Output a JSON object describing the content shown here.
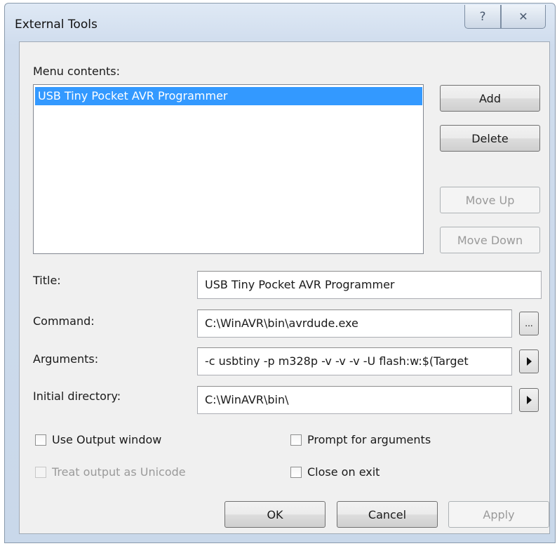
{
  "window": {
    "title": "External Tools",
    "help_glyph": "?",
    "close_glyph": "✕"
  },
  "menu_contents": {
    "label": "Menu contents:",
    "items": [
      "USB Tiny Pocket AVR Programmer"
    ],
    "selected_index": 0
  },
  "side_buttons": {
    "add": "Add",
    "delete": "Delete",
    "move_up": "Move Up",
    "move_down": "Move Down"
  },
  "fields": {
    "title": {
      "label": "Title:",
      "value": "USB Tiny Pocket AVR Programmer"
    },
    "command": {
      "label": "Command:",
      "value": "C:\\WinAVR\\bin\\avrdude.exe",
      "browse_label": "..."
    },
    "arguments": {
      "label": "Arguments:",
      "value": "-c usbtiny -p m328p -v -v -v -U flash:w:$(Target"
    },
    "initial_directory": {
      "label": "Initial directory:",
      "value": "C:\\WinAVR\\bin\\"
    }
  },
  "options": {
    "use_output_window": {
      "label": "Use Output window",
      "checked": false,
      "enabled": true
    },
    "treat_output_unicode": {
      "label": "Treat output as Unicode",
      "checked": false,
      "enabled": false
    },
    "prompt_for_arguments": {
      "label": "Prompt for arguments",
      "checked": false,
      "enabled": true
    },
    "close_on_exit": {
      "label": "Close on exit",
      "checked": false,
      "enabled": true
    }
  },
  "footer": {
    "ok": "OK",
    "cancel": "Cancel",
    "apply": "Apply"
  },
  "colors": {
    "selection": "#3399ff",
    "titlebar": "#cfdced",
    "client_bg": "#f0f0f0",
    "disabled_text": "#9a9a9a"
  },
  "icons": {
    "arguments_menu": "right-arrow-icon",
    "directory_menu": "right-arrow-icon"
  }
}
